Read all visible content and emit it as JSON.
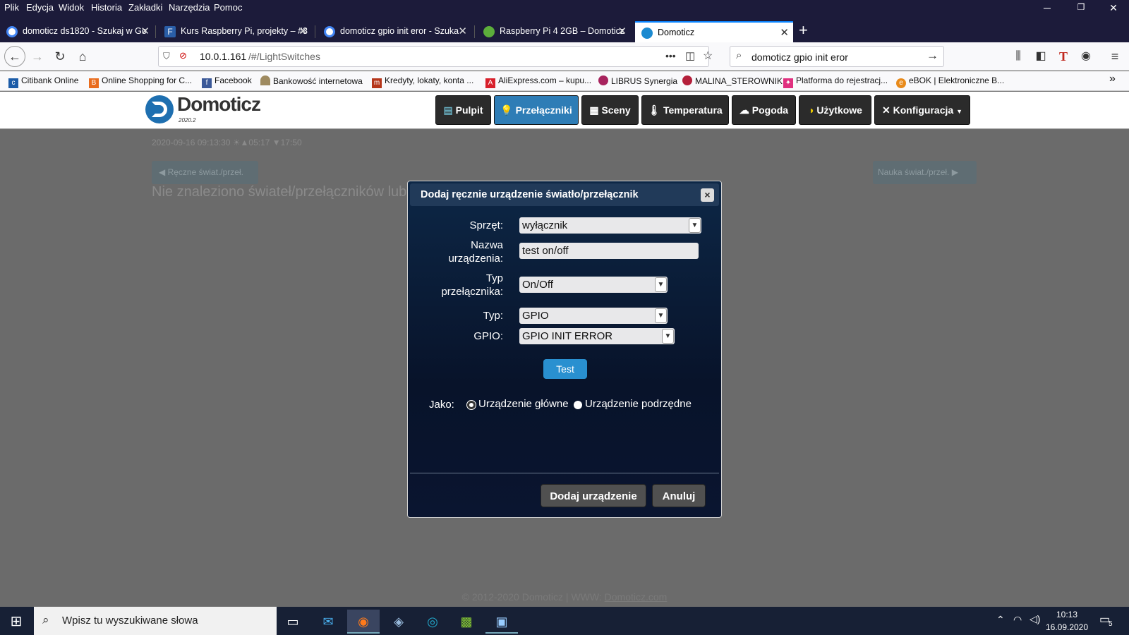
{
  "menu": [
    "Plik",
    "Edycja",
    "Widok",
    "Historia",
    "Zakładki",
    "Narzędzia",
    "Pomoc"
  ],
  "tabs": [
    {
      "title": "domoticz ds1820 - Szukaj w Go",
      "icon": "google-icon"
    },
    {
      "title": "Kurs Raspberry Pi, projekty – #3",
      "icon": "forbot-icon"
    },
    {
      "title": "domoticz gpio init eror - Szuka",
      "icon": "google-icon"
    },
    {
      "title": "Raspberry Pi 4 2GB – Domoticz",
      "icon": "raspberry-icon"
    },
    {
      "title": "Domoticz",
      "icon": "domoticz-icon"
    }
  ],
  "nav": {
    "url": "10.0.1.161/#/LightSwitches",
    "url_host": "10.0.1.161",
    "url_path": "/#/LightSwitches",
    "search": "domoticz gpio init eror",
    "more": "•••"
  },
  "bookmarks": [
    "Citibank Online",
    "Online Shopping for C...",
    "Facebook",
    "Bankowość internetowa",
    "Kredyty, lokaty, konta ...",
    "AliExpress.com – kupu...",
    "LIBRUS Synergia",
    "MALINA_STEROWNIK",
    "Platforma do rejestracj...",
    "eBOK | Elektroniczne B..."
  ],
  "app": {
    "logo": "Domoticz",
    "version": "2020.2"
  },
  "topnav": [
    "Pulpit",
    "Przełączniki",
    "Sceny",
    "Temperatura",
    "Pogoda",
    "Użytkowe",
    "Konfiguracja"
  ],
  "status_line": "2020-09-16 09:13:30 ☀▲05:17 ▼17:50",
  "left_btn": "Ręczne świat./przeł.",
  "right_btn": "Nauka świat./przeł.",
  "empty_msg": "Nie znaleziono świateł/przełączników lub",
  "dialog": {
    "title": "Dodaj ręcznie urządzenie światło/przełącznik",
    "close": "×",
    "hw_label": "Sprzęt:",
    "hw_value": "wyłącznik",
    "name_label_1": "Nazwa",
    "name_label_2": "urządzenia:",
    "name_value": "test on/off",
    "type_label_1": "Typ",
    "type_label_2": "przełącznika:",
    "switch_type": "On/Off",
    "typ_label": "Typ:",
    "typ_value": "GPIO",
    "gpio_label": "GPIO:",
    "gpio_value": "GPIO INIT ERROR",
    "test": "Test",
    "jako": "Jako:",
    "main_dev": "Urządzenie główne",
    "sub_dev": "Urządzenie podrzędne",
    "add": "Dodaj urządzenie",
    "cancel": "Anuluj"
  },
  "footer": {
    "text": "© 2012-2020 Domoticz | WWW:",
    "link": "Domoticz.com"
  },
  "taskbar": {
    "search_placeholder": "Wpisz tu wyszukiwane słowa",
    "time": "10:13",
    "date": "16.09.2020",
    "notif": "5"
  }
}
